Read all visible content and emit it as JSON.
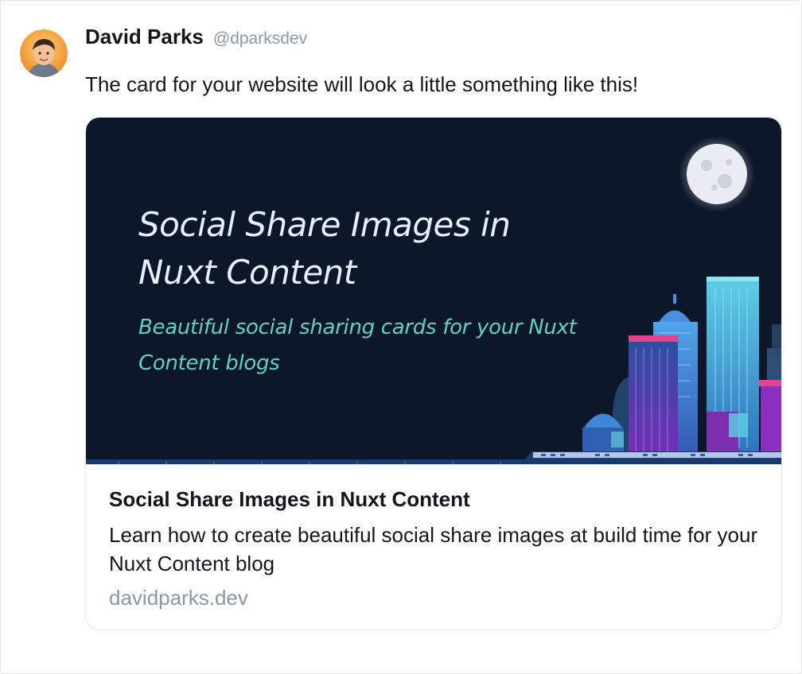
{
  "tweet": {
    "author_name": "David Parks",
    "author_handle": "@dparksdev",
    "text": "The card for your website will look a little something like this!"
  },
  "card": {
    "image": {
      "title": "Social Share Images in Nuxt Content",
      "subtitle": "Beautiful social sharing cards for your Nuxt Content blogs",
      "background_color": "#0c1729",
      "title_color": "#e8eef6",
      "subtitle_color": "#5fd3c1"
    },
    "title": "Social Share Images in Nuxt Content",
    "description": "Learn how to create beautiful social share images at build time for your Nuxt Content blog",
    "domain": "davidparks.dev"
  },
  "colors": {
    "text_primary": "#14171a",
    "text_secondary": "#8899a6",
    "border": "#e1e8ed"
  }
}
